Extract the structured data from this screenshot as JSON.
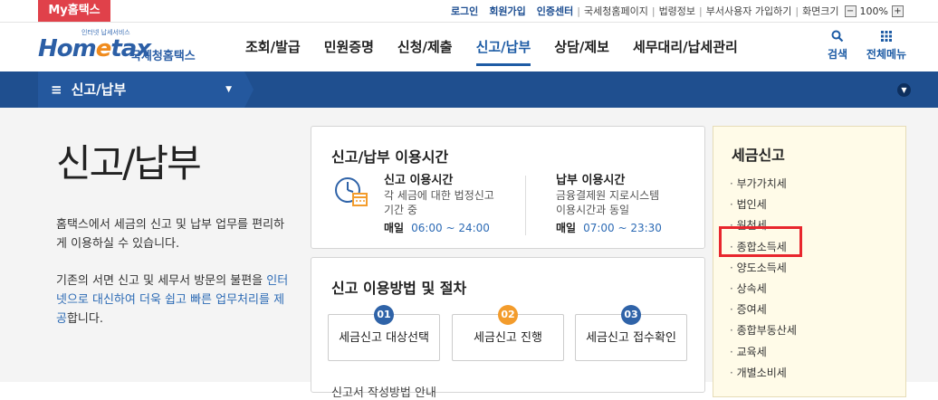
{
  "top_bar": {
    "my_hometax": "My홈택스",
    "links": [
      "로그인",
      "회원가입",
      "인증센터"
    ],
    "sub_links": [
      "국세청홈페이지",
      "법령정보",
      "부서사용자 가입하기",
      "화면크기"
    ],
    "zoom_value": "100%"
  },
  "logo": {
    "tagline": "인터넷 납세서비스",
    "word_a": "Hom",
    "word_e": "e",
    "word_b": "tax",
    "korean": "국세청홈택스"
  },
  "gnb": [
    "조회/발급",
    "민원증명",
    "신청/제출",
    "신고/납부",
    "상담/제보",
    "세무대리/납세관리"
  ],
  "gnb_active_index": 3,
  "header_buttons": {
    "search": "검색",
    "all_menu": "전체메뉴"
  },
  "breadcrumb": {
    "label": "신고/납부"
  },
  "intro": {
    "title": "신고/납부",
    "para1": "홈택스에서 세금의 신고 및 납부 업무를 편리하게 이용하실 수 있습니다.",
    "para2_a": "기존의 서면 신고 및 세무서 방문의 불편을 ",
    "para2_b": "인터넷으로 대신하여 더욱 쉽고 빠른 업무처리를 제공",
    "para2_c": "합니다."
  },
  "usage_time": {
    "title": "신고/납부 이용시간",
    "filing": {
      "title": "신고 이용시간",
      "desc1": "각 세금에 대한 법정신고",
      "desc2": "기간 중",
      "day": "매일",
      "time": "06:00 ~ 24:00"
    },
    "payment": {
      "title": "납부 이용시간",
      "desc1": "금융결제원 지로시스템",
      "desc2": "이용시간과 동일",
      "day": "매일",
      "time": "07:00 ~ 23:30"
    }
  },
  "procedure": {
    "title": "신고 이용방법 및 절차",
    "steps": [
      {
        "num": "01",
        "label": "세금신고 대상선택",
        "color": "#2f63a8"
      },
      {
        "num": "02",
        "label": "세금신고 진행",
        "color": "#f39c2c"
      },
      {
        "num": "03",
        "label": "세금신고 접수확인",
        "color": "#2f63a8"
      }
    ],
    "next_heading": "신고서 작성방법 안내"
  },
  "tax_menu": {
    "title": "세금신고",
    "items": [
      "부가가치세",
      "법인세",
      "원천세",
      "종합소득세",
      "양도소득세",
      "상속세",
      "증여세",
      "종합부동산세",
      "교육세",
      "개별소비세"
    ],
    "highlighted": "종합소득세"
  },
  "colors": {
    "brand_blue": "#1f4f8f",
    "accent_red": "#e0414a",
    "highlight": "#e8262d"
  }
}
